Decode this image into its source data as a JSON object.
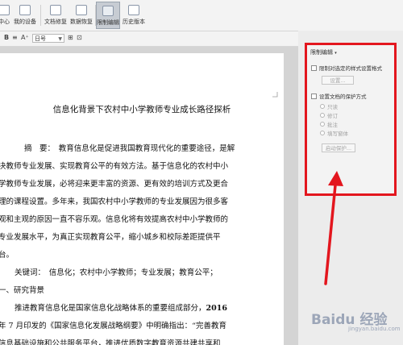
{
  "toolbar": {
    "items": [
      {
        "label": "中心",
        "icon": "home-icon"
      },
      {
        "label": "我的设备",
        "icon": "device-icon"
      },
      {
        "label": "文档修复",
        "icon": "document-repair-icon"
      },
      {
        "label": "数据恢复",
        "icon": "data-recovery-icon"
      },
      {
        "label": "限制编辑",
        "icon": "restrict-edit-icon",
        "active": true
      },
      {
        "label": "历史版本",
        "icon": "history-icon"
      }
    ]
  },
  "format_bar": {
    "bold": "B",
    "font_size_up": "A⁺",
    "font_name": "日号"
  },
  "document": {
    "title": "信息化背景下农村中小学教师专业成长路径探析",
    "lines": [
      "摘　要：　教育信息化是促进我国教育现代化的重要途径，是解",
      "决教师专业发展、实现教育公平的有效方法。基于信息化的农村中小",
      "学教师专业发展，必将迎来更丰富的资源、更有效的培训方式及更合",
      "理的课程设置。多年来，我国农村中小学教师的专业发展因为很多客",
      "观和主观的原因一直不容乐观。信息化将有效提高农村中小学教师的",
      "专业发展水平，为真正实现教育公平，缩小城乡和校际差距提供平",
      "台。",
      "关键词：　信息化；农村中小学教师；专业发展；教育公平；",
      "一、研究背景",
      "推进教育信息化是国家信息化战略体系的重要组成部分，",
      "年 7 月印发的《国家信息化发展战略纲要》中明确指出：“完善教育",
      "信息基础设施和公共服务平台，推进优质数字教育资源共建共享和"
    ],
    "bold_year": "2016"
  },
  "panel": {
    "title": "限制编辑",
    "option1": "限制对选定的样式设置格式",
    "settings_button": "设置...",
    "option2": "设置文档的保护方式",
    "radios": [
      "只读",
      "修订",
      "批注",
      "填写窗体"
    ],
    "start_button": "启动保护..."
  },
  "watermark": {
    "brand": "Baidu 经验",
    "sub": "jingyan.baidu.com"
  },
  "colors": {
    "highlight_red": "#e3161e",
    "toolbar_bg": "#f3f3f3",
    "panel_bg": "#ececec"
  }
}
